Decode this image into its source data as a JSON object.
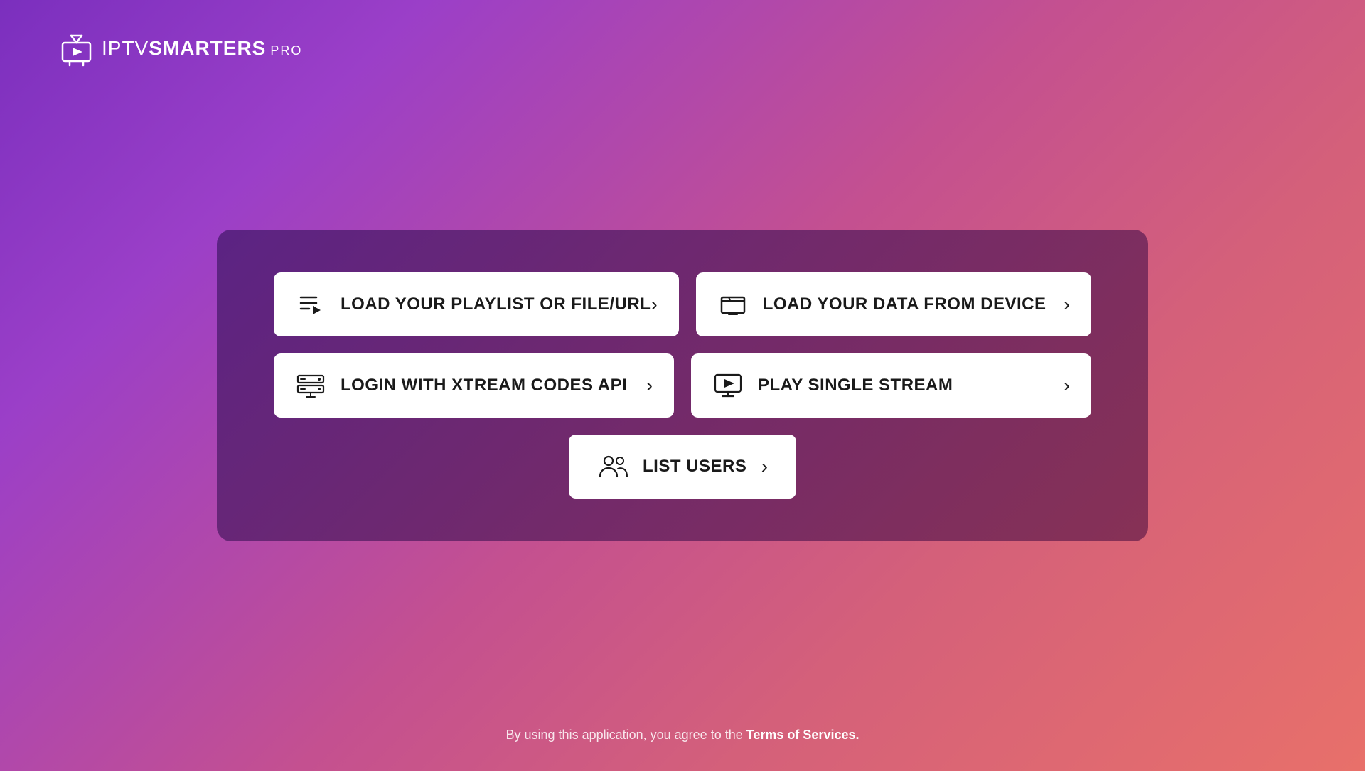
{
  "app": {
    "logo_iptv": "IPTV",
    "logo_smarters": "SMARTERS",
    "logo_pro": "PRO"
  },
  "buttons": {
    "load_playlist": {
      "label": "LOAD YOUR PLAYLIST OR FILE/URL",
      "icon": "playlist-icon"
    },
    "load_device": {
      "label": "LOAD YOUR DATA FROM DEVICE",
      "icon": "device-icon"
    },
    "login_xtream": {
      "label": "LOGIN WITH XTREAM CODES API",
      "icon": "xtream-icon"
    },
    "play_single": {
      "label": "PLAY SINGLE STREAM",
      "icon": "stream-icon"
    },
    "list_users": {
      "label": "LIST USERS",
      "icon": "users-icon"
    }
  },
  "footer": {
    "text": "By using this application, you agree to the ",
    "link_text": "Terms of Services."
  },
  "colors": {
    "bg_gradient_start": "#7B2FBE",
    "bg_gradient_end": "#E8706A",
    "card_bg": "rgba(80,30,120,0.85)",
    "button_bg": "#FFFFFF",
    "text_dark": "#1a1a1a",
    "text_white": "#FFFFFF"
  }
}
